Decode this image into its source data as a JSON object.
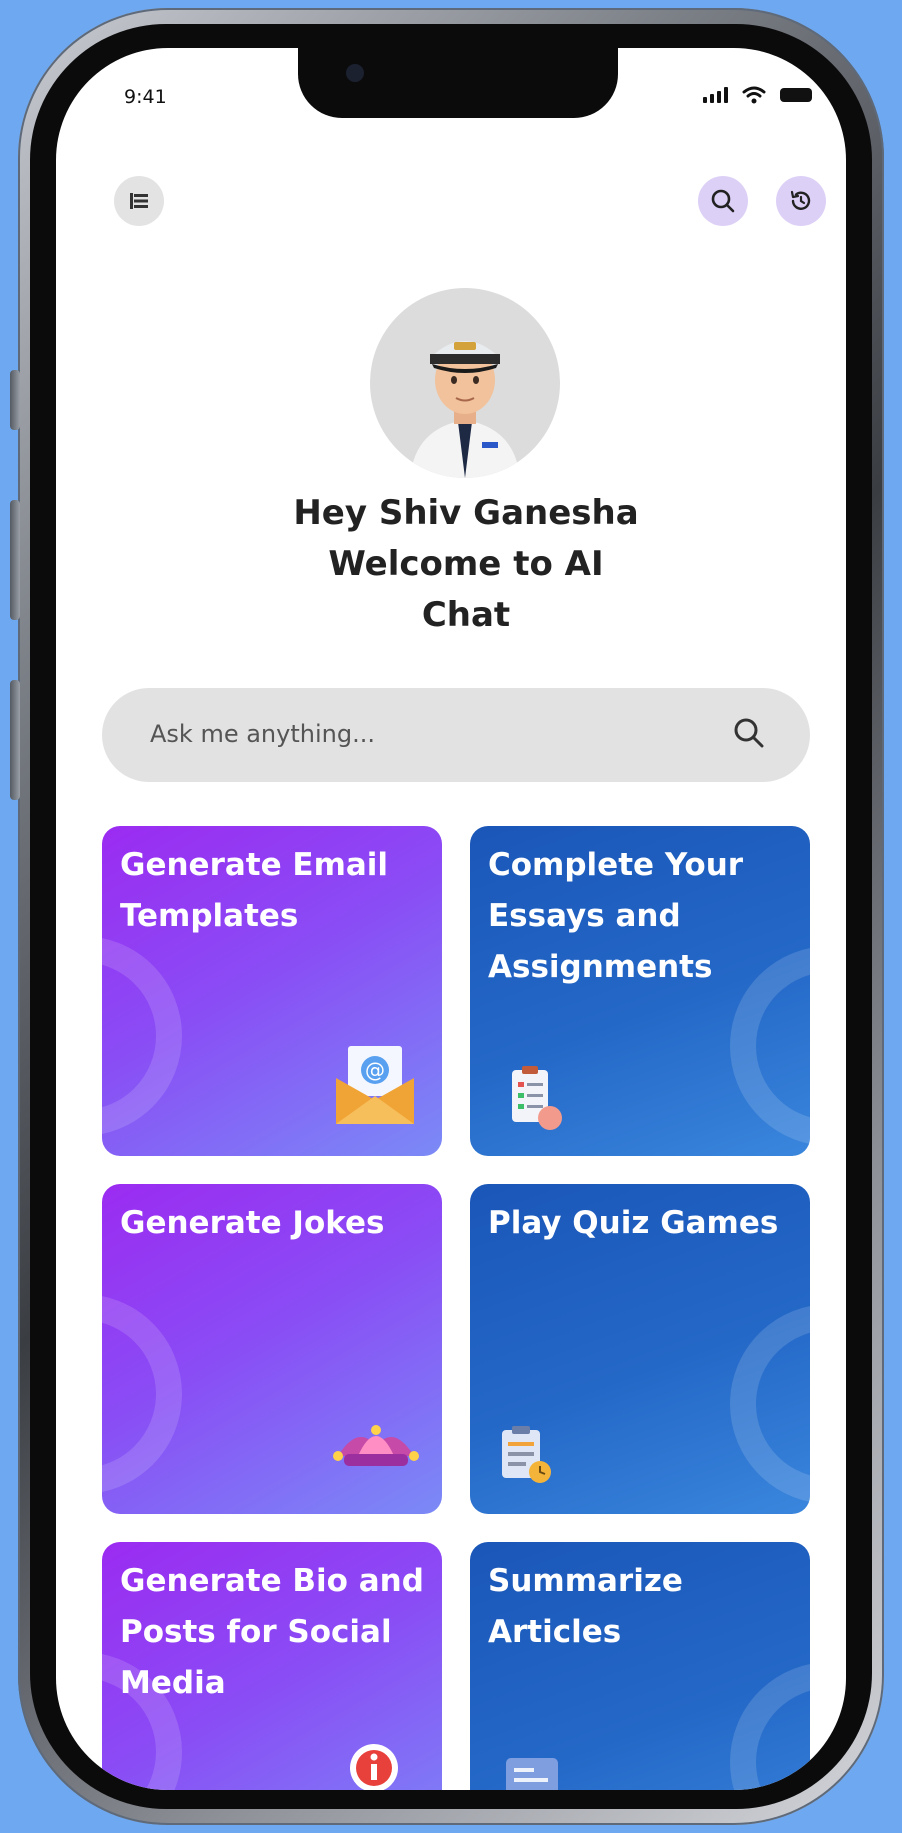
{
  "status_bar": {
    "time": "9:41"
  },
  "header": {
    "menu_icon": "menu-list-icon",
    "search_icon": "search-icon",
    "history_icon": "history-icon"
  },
  "greeting": {
    "line1": "Hey Shiv Ganesha",
    "line2": "Welcome to AI",
    "line3": "Chat"
  },
  "search": {
    "placeholder": "Ask me anything..."
  },
  "cards": [
    {
      "title": "Generate Email Templates",
      "icon": "email-envelope-icon"
    },
    {
      "title": "Complete Your Essays and Assignments",
      "icon": "clipboard-checklist-icon"
    },
    {
      "title": "Generate Jokes",
      "icon": "jester-hat-icon"
    },
    {
      "title": "Play Quiz Games",
      "icon": "quiz-clipboard-icon"
    },
    {
      "title": "Generate Bio and Posts for Social Media",
      "icon": "info-badge-icon"
    },
    {
      "title": "Summarize Articles",
      "icon": "document-card-icon"
    }
  ],
  "colors": {
    "background": "#6ea8f0",
    "purple_card": "#9b2bf1",
    "blue_card": "#1a56b8",
    "icon_button_tint": "#ddd0f7"
  }
}
